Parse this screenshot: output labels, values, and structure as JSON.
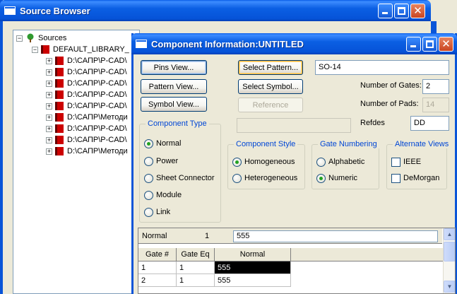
{
  "source_browser": {
    "title": "Source Browser",
    "tree": {
      "root": "Sources",
      "library": "DEFAULT_LIBRARY_",
      "items": [
        "D:\\САПР\\P-CAD\\",
        "D:\\САПР\\P-CAD\\",
        "D:\\САПР\\P-CAD\\",
        "D:\\САПР\\P-CAD\\",
        "D:\\САПР\\P-CAD\\",
        "D:\\САПР\\Методи",
        "D:\\САПР\\P-CAD\\",
        "D:\\САПР\\P-CAD\\",
        "D:\\САПР\\Методи"
      ]
    }
  },
  "dialog": {
    "title": "Component Information:UNTITLED",
    "buttons": {
      "pins_view": "Pins View...",
      "pattern_view": "Pattern View...",
      "symbol_view": "Symbol View...",
      "select_pattern": "Select Pattern...",
      "select_symbol": "Select Symbol...",
      "reference": "Reference"
    },
    "pattern_name": "SO-14",
    "number_of_gates_label": "Number of Gates:",
    "number_of_gates": "2",
    "number_of_pads_label": "Number of Pads:",
    "number_of_pads": "14",
    "reference_field": "",
    "refdes_label": "Refdes",
    "refdes": "DD",
    "component_type": {
      "title": "Component Type",
      "options": [
        "Normal",
        "Power",
        "Sheet Connector",
        "Module",
        "Link"
      ],
      "selected": "Normal"
    },
    "component_style": {
      "title": "Component Style",
      "options": [
        "Homogeneous",
        "Heterogeneous"
      ],
      "selected": "Homogeneous"
    },
    "gate_numbering": {
      "title": "Gate Numbering",
      "options": [
        "Alphabetic",
        "Numeric"
      ],
      "selected": "Numeric"
    },
    "alternate_views": {
      "title": "Alternate Views",
      "options": [
        "IEEE",
        "DeMorgan"
      ]
    },
    "table": {
      "header_type": "Normal",
      "header_number": "1",
      "header_value": "555",
      "columns": [
        "Gate #",
        "Gate Eq",
        "Normal"
      ],
      "rows": [
        [
          "1",
          "1",
          "555"
        ],
        [
          "2",
          "1",
          "555"
        ]
      ]
    }
  },
  "colors": {
    "title_blue": "#0b5fe3",
    "group_title": "#0046d5",
    "face": "#ece9d8"
  }
}
